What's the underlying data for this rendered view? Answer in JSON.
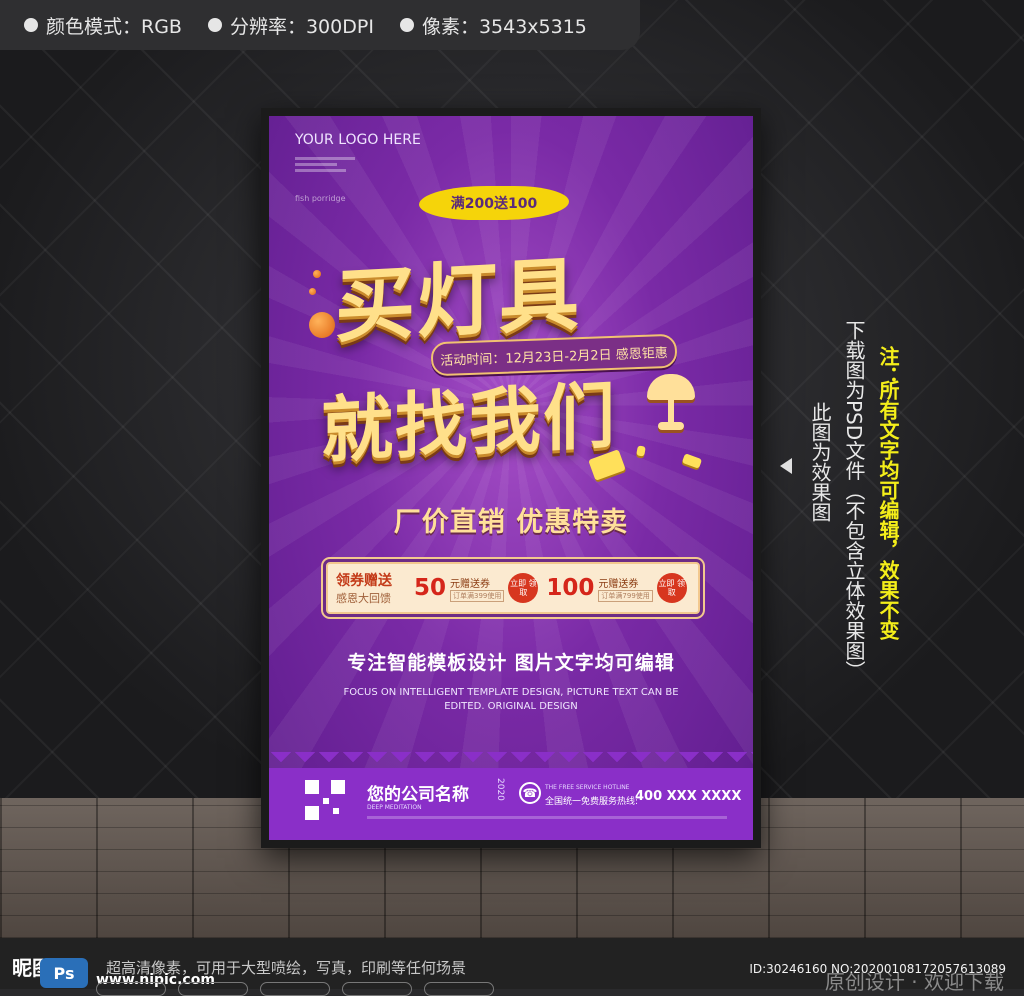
{
  "top_info": {
    "color_mode": "颜色模式：RGB",
    "resolution": "分辨率：300DPI",
    "pixels": "像素：3543x5315"
  },
  "poster": {
    "logo": "YOUR LOGO HERE",
    "logo_tag": "fish porridge",
    "promo_tag": "满200送100",
    "headline_line1": "买灯具",
    "headline_line2": "就找我们",
    "date_pill": "活动时间：12月23日-2月2日 感恩钜惠",
    "subhead": "厂价直销  优惠特卖",
    "coupon_title": "领券赠送",
    "coupon_subtitle": "感恩大回馈",
    "coupons": [
      {
        "amount": "50",
        "label": "元赠送券",
        "note": "订单满399使用",
        "claim": "立即 领取"
      },
      {
        "amount": "100",
        "label": "元赠送券",
        "note": "订单满799使用",
        "claim": "立即 领取"
      }
    ],
    "tagline": "专注智能模板设计  图片文字均可编辑",
    "tagline_en": "FOCUS ON INTELLIGENT TEMPLATE DESIGN, PICTURE TEXT CAN BE EDITED. ORIGINAL DESIGN",
    "company": "您的公司名称",
    "company_en": "DEEP MEDITATION",
    "company_year": "2020",
    "hotline_en": "THE FREE SERVICE HOTLINE",
    "hotline_cn": "全国统一免费服务热线:",
    "phone": "400 XXX XXXX"
  },
  "side_notes": {
    "effect": "此图为效果图",
    "download": "下载图为PSD文件（不包含立体效果图）",
    "note_label": "注：",
    "note": "所有文字均可编辑，效果不变"
  },
  "bottom": {
    "site_logo": "昵图网",
    "ps_badge": "Ps",
    "site_url": "www.nipic.com",
    "site_desc": "超高清像素，可用于大型喷绘，写真，印刷等任何场景",
    "id_text": "ID:30246160 NO:20200108172057613089",
    "orig_text": "原创设计 · 欢迎下载"
  },
  "colors": {
    "poster_purple": "#7a2aa6",
    "headline_gold": "#ffe08a",
    "note_yellow": "#f4ee1a"
  }
}
